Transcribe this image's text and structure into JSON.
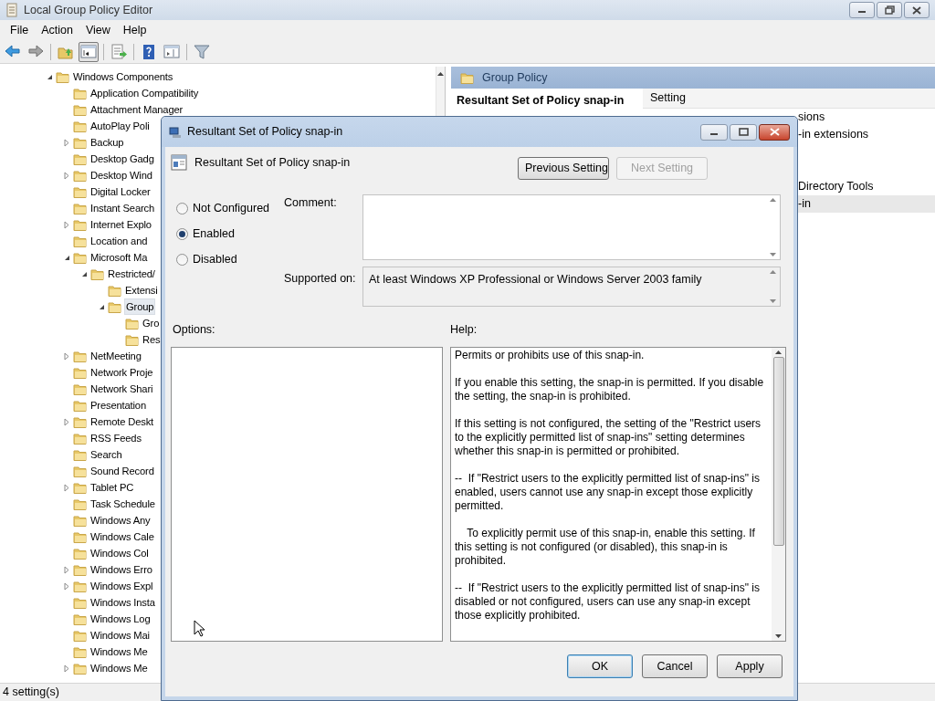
{
  "window": {
    "title": "Local Group Policy Editor"
  },
  "menu": [
    "File",
    "Action",
    "View",
    "Help"
  ],
  "toolbar": [
    {
      "kind": "back",
      "pressed": false
    },
    {
      "kind": "forward",
      "pressed": false
    },
    {
      "kind": "sep"
    },
    {
      "kind": "folder-up",
      "pressed": false
    },
    {
      "kind": "tree-toggle",
      "pressed": true
    },
    {
      "kind": "sep"
    },
    {
      "kind": "export",
      "pressed": false
    },
    {
      "kind": "sep"
    },
    {
      "kind": "help",
      "pressed": false
    },
    {
      "kind": "pane",
      "pressed": false
    },
    {
      "kind": "sep"
    },
    {
      "kind": "filter",
      "pressed": false
    }
  ],
  "tree": [
    {
      "label": "Windows Components",
      "kind": "branch",
      "expanded": true,
      "selected": false,
      "children": [
        {
          "label": "Application Compatibility",
          "kind": "leaf",
          "selected": false
        },
        {
          "label": "Attachment Manager",
          "kind": "leaf",
          "selected": false
        },
        {
          "label": "AutoPlay Poli",
          "kind": "leaf",
          "selected": false
        },
        {
          "label": "Backup",
          "kind": "branch",
          "expanded": false,
          "selected": false
        },
        {
          "label": "Desktop Gadg",
          "kind": "leaf",
          "selected": false
        },
        {
          "label": "Desktop Wind",
          "kind": "branch",
          "expanded": false,
          "selected": false
        },
        {
          "label": "Digital Locker",
          "kind": "leaf",
          "selected": false
        },
        {
          "label": "Instant Search",
          "kind": "leaf",
          "selected": false
        },
        {
          "label": "Internet Explo",
          "kind": "branch",
          "expanded": false,
          "selected": false
        },
        {
          "label": "Location and",
          "kind": "leaf",
          "selected": false
        },
        {
          "label": "Microsoft Ma",
          "kind": "branch",
          "expanded": true,
          "selected": false,
          "children": [
            {
              "label": "Restricted/",
              "kind": "branch",
              "expanded": true,
              "selected": false,
              "children": [
                {
                  "label": "Extensi",
                  "kind": "leaf",
                  "selected": false
                },
                {
                  "label": "Group",
                  "kind": "branch",
                  "expanded": true,
                  "selected": true,
                  "children": [
                    {
                      "label": "Gro",
                      "kind": "leaf",
                      "selected": false
                    },
                    {
                      "label": "Res",
                      "kind": "leaf",
                      "selected": false
                    }
                  ]
                }
              ]
            }
          ]
        },
        {
          "label": "NetMeeting",
          "kind": "branch",
          "expanded": false,
          "selected": false
        },
        {
          "label": "Network Proje",
          "kind": "leaf",
          "selected": false
        },
        {
          "label": "Network Shari",
          "kind": "leaf",
          "selected": false
        },
        {
          "label": "Presentation",
          "kind": "leaf",
          "selected": false
        },
        {
          "label": "Remote Deskt",
          "kind": "branch",
          "expanded": false,
          "selected": false
        },
        {
          "label": "RSS Feeds",
          "kind": "leaf",
          "selected": false
        },
        {
          "label": "Search",
          "kind": "leaf",
          "selected": false
        },
        {
          "label": "Sound Record",
          "kind": "leaf",
          "selected": false
        },
        {
          "label": "Tablet PC",
          "kind": "branch",
          "expanded": false,
          "selected": false
        },
        {
          "label": "Task Schedule",
          "kind": "leaf",
          "selected": false
        },
        {
          "label": "Windows Any",
          "kind": "leaf",
          "selected": false
        },
        {
          "label": "Windows Cale",
          "kind": "leaf",
          "selected": false
        },
        {
          "label": "Windows Col",
          "kind": "leaf",
          "selected": false
        },
        {
          "label": "Windows Erro",
          "kind": "branch",
          "expanded": false,
          "selected": false
        },
        {
          "label": "Windows Expl",
          "kind": "branch",
          "expanded": false,
          "selected": false
        },
        {
          "label": "Windows Insta",
          "kind": "leaf",
          "selected": false
        },
        {
          "label": "Windows Log",
          "kind": "leaf",
          "selected": false
        },
        {
          "label": "Windows Mai",
          "kind": "leaf",
          "selected": false
        },
        {
          "label": "Windows Me",
          "kind": "leaf",
          "selected": false
        },
        {
          "label": "Windows Me",
          "kind": "branch",
          "expanded": false,
          "selected": false
        }
      ]
    }
  ],
  "details": {
    "header": "Group Policy",
    "selected_title": "Resultant Set of Policy snap-in",
    "column": "Setting",
    "rows": [
      {
        "name": "sions",
        "selected": false
      },
      {
        "name": "-in extensions",
        "selected": false
      },
      {
        "name": "Directory Tools",
        "selected": false
      },
      {
        "name": "-in",
        "selected": true
      }
    ]
  },
  "status_bar": "4 setting(s)",
  "dialog": {
    "title": "Resultant Set of Policy snap-in",
    "heading": "Resultant Set of Policy snap-in",
    "nav_buttons": [
      {
        "label": "Previous Setting",
        "disabled": false
      },
      {
        "label": "Next Setting",
        "disabled": true
      }
    ],
    "states": [
      {
        "label": "Not Configured",
        "selected": false
      },
      {
        "label": "Enabled",
        "selected": true
      },
      {
        "label": "Disabled",
        "selected": false
      }
    ],
    "comment_label": "Comment:",
    "supported_label": "Supported on:",
    "supported": "At least Windows XP Professional or Windows Server 2003 family",
    "options_label": "Options:",
    "help_label": "Help:",
    "help": [
      "Permits or prohibits use of this snap-in.",
      "If you enable this setting, the snap-in is permitted. If you disable the setting, the snap-in is prohibited.",
      "If this setting is not configured, the setting of the \"Restrict users to the explicitly permitted list of snap-ins\" setting determines whether this snap-in is permitted or prohibited.",
      "--  If \"Restrict users to the explicitly permitted list of snap-ins\" is enabled, users cannot use any snap-in except those explicitly permitted.",
      "    To explicitly permit use of this snap-in, enable this setting. If this setting is not configured (or disabled), this snap-in is prohibited.",
      "--  If \"Restrict users to the explicitly permitted list of snap-ins\" is disabled or not configured, users can use any snap-in except those explicitly prohibited."
    ],
    "buttons": [
      {
        "label": "OK",
        "default": true
      },
      {
        "label": "Cancel",
        "default": false
      },
      {
        "label": "Apply",
        "default": false
      }
    ]
  }
}
